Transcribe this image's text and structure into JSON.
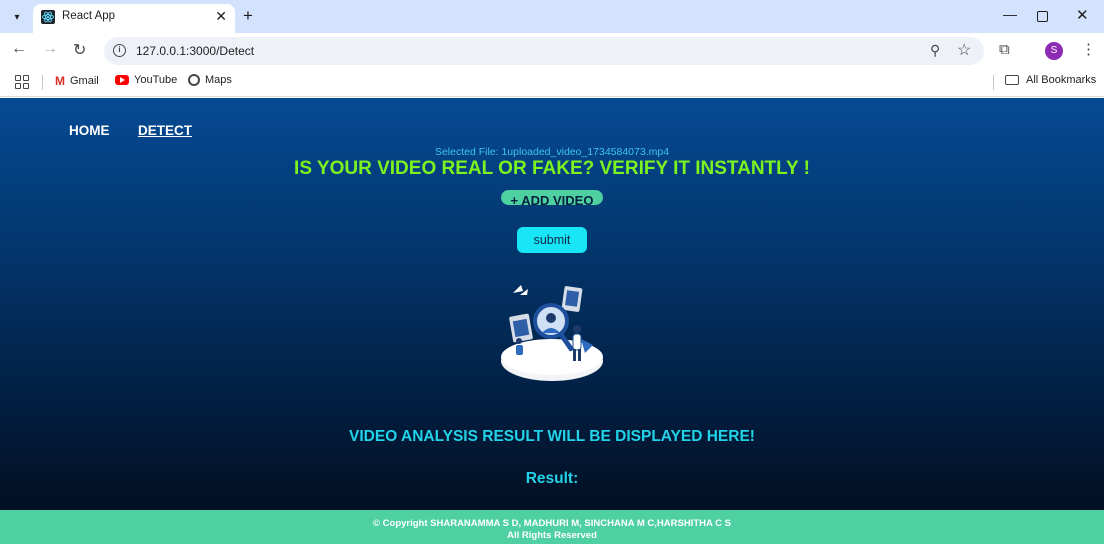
{
  "browser": {
    "tab_title": "React App",
    "url": "127.0.0.1:3000/Detect",
    "profile_initial": "S",
    "bookmarks": [
      "Gmail",
      "YouTube",
      "Maps"
    ],
    "all_bookmarks": "All Bookmarks"
  },
  "nav": {
    "home": "HOME",
    "detect": "DETECT"
  },
  "detect": {
    "selected_file": "Selected File: 1uploaded_video_1734584073.mp4",
    "headline": "IS YOUR VIDEO REAL OR FAKE? VERIFY IT INSTANTLY !",
    "add_video_label": "+ ADD VIDEO",
    "submit_label": "submit",
    "result_heading": "VIDEO ANALYSIS RESULT WILL BE DISPLAYED HERE!",
    "result_label": "Result:"
  },
  "footer": {
    "copyright": "© Copyright SHARANAMMA S D, MADHURI M, SINCHANA M C,HARSHITHA C S",
    "rights": "All Rights Reserved"
  },
  "colors": {
    "headline": "#7cf21e",
    "accent_cyan": "#22d3e8",
    "footer_bg": "#4fd0a2",
    "submit_bg": "#18e5f5"
  }
}
